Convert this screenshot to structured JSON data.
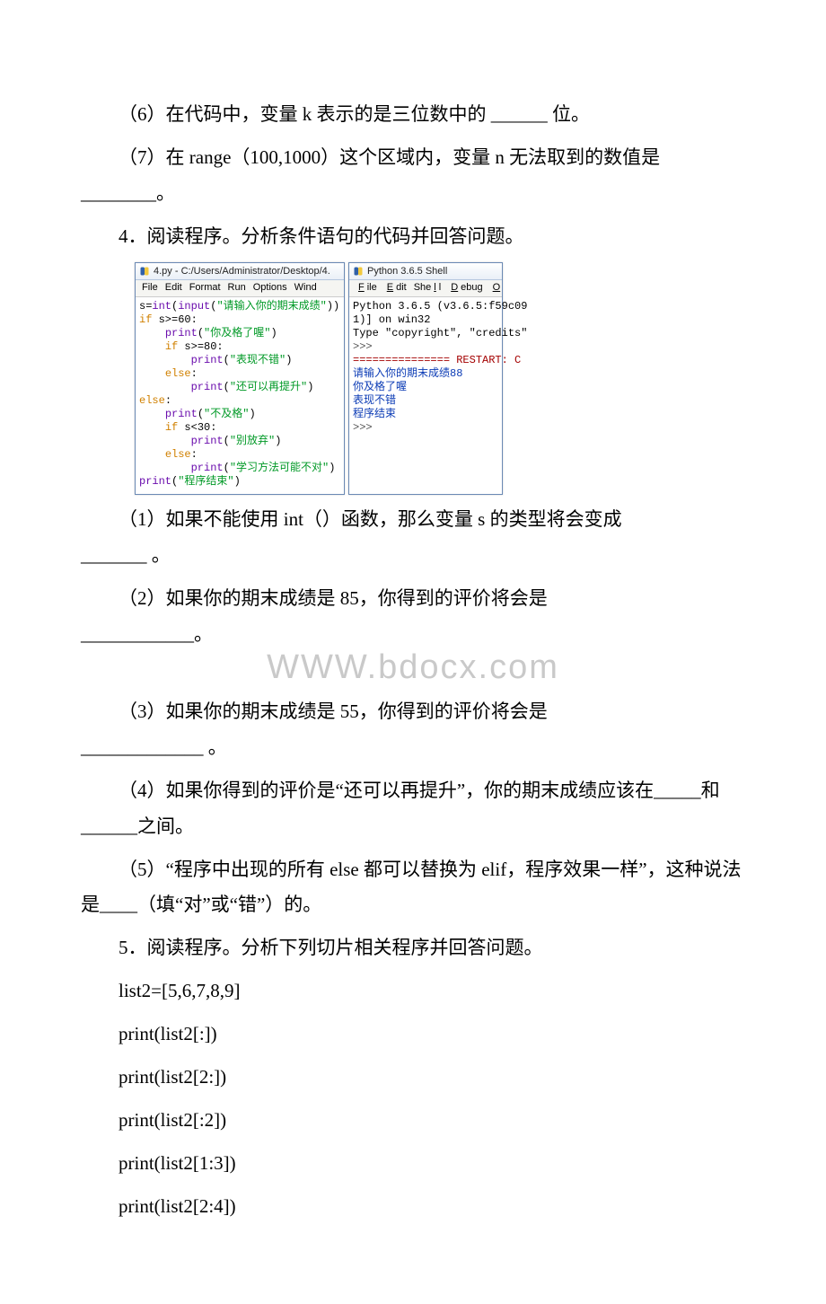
{
  "q6": "（6）在代码中，变量 k 表示的是三位数中的 ______ 位。",
  "q7a": "（7）在 range（100,1000）这个区域内，变量 n 无法取到的数值是",
  "q7b": "________。",
  "q4": "4．阅读程序。分析条件语句的代码并回答问题。",
  "editor": {
    "title": "4.py - C:/Users/Administrator/Desktop/4.",
    "menu": [
      "File",
      "Edit",
      "Format",
      "Run",
      "Options",
      "Wind"
    ]
  },
  "code": {
    "l1a": "s=",
    "l1b": "int",
    "l1c": "(",
    "l1d": "input",
    "l1e": "(",
    "l1f": "\"请输入你的期末成绩\"",
    "l1g": "))",
    "l2a": "if",
    "l2b": " s>=60:",
    "l3a": "    ",
    "l3b": "print",
    "l3c": "(",
    "l3d": "\"你及格了喔\"",
    "l3e": ")",
    "l4a": "    ",
    "l4b": "if",
    "l4c": " s>=80:",
    "l5a": "        ",
    "l5b": "print",
    "l5c": "(",
    "l5d": "\"表现不错\"",
    "l5e": ")",
    "l6a": "    ",
    "l6b": "else",
    "l6c": ":",
    "l7a": "        ",
    "l7b": "print",
    "l7c": "(",
    "l7d": "\"还可以再提升\"",
    "l7e": ")",
    "l8a": "else",
    "l8b": ":",
    "l9a": "    ",
    "l9b": "print",
    "l9c": "(",
    "l9d": "\"不及格\"",
    "l9e": ")",
    "l10a": "    ",
    "l10b": "if",
    "l10c": " s<30:",
    "l11a": "        ",
    "l11b": "print",
    "l11c": "(",
    "l11d": "\"别放弃\"",
    "l11e": ")",
    "l12a": "    ",
    "l12b": "else",
    "l12c": ":",
    "l13a": "        ",
    "l13b": "print",
    "l13c": "(",
    "l13d": "\"学习方法可能不对\"",
    "l13e": ")",
    "l14a": "print",
    "l14b": "(",
    "l14c": "\"程序结束\"",
    "l14d": ")"
  },
  "shell": {
    "title": "Python 3.6.5 Shell",
    "menu": {
      "file": "File",
      "edit": "Edit",
      "shell": "Shell",
      "debug": "Debug",
      "opti": "Opti"
    },
    "line1": "Python 3.6.5 (v3.6.5:f59c09",
    "line2": "1)] on win32",
    "line3": "Type \"copyright\", \"credits\"",
    "p1": ">>>",
    "restart": "=============== RESTART: C",
    "in1": "请输入你的期末成绩88",
    "out1": "你及格了喔",
    "out2": "表现不错",
    "out3": "程序结束",
    "p2": ">>>"
  },
  "q4_1a": "（1）如果不能使用 int（）函数，那么变量 s 的类型将会变成",
  "q4_1b": "_______ 。",
  "q4_2a": "（2）如果你的期末成绩是 85，你得到的评价将会是",
  "q4_2b": "____________。",
  "watermark": "WWW.bdocx.com",
  "q4_3a": "（3）如果你的期末成绩是 55，你得到的评价将会是",
  "q4_3b": "_____________ 。",
  "q4_4": "（4）如果你得到的评价是“还可以再提升”，你的期末成绩应该在_____和______之间。",
  "q4_5": "（5）“程序中出现的所有 else 都可以替换为 elif，程序效果一样”，这种说法是____（填“对”或“错”）的。",
  "q5": "5．阅读程序。分析下列切片相关程序并回答问题。",
  "slice": {
    "l1": "list2=[5,6,7,8,9]",
    "l2": "print(list2[:])",
    "l3": "print(list2[2:])",
    "l4": "print(list2[:2])",
    "l5": "print(list2[1:3])",
    "l6": "print(list2[2:4])"
  }
}
